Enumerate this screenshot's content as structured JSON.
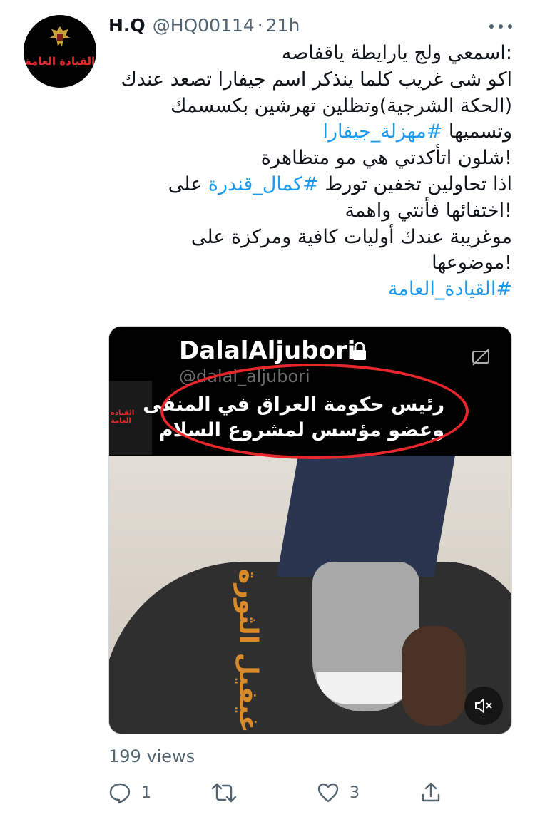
{
  "tweet": {
    "author": {
      "name": "H.Q",
      "handle": "@HQ00114",
      "separator": "·",
      "time": "21h",
      "avatar_text": "القيادة العامة"
    },
    "lines": [
      [
        {
          "text": ":اسمعي ولج يارايطة ياقفاصه",
          "tag": false
        }
      ],
      [
        {
          "text": "اكو شى غريب كلما ينذكر اسم جيفارا تصعد عندك",
          "tag": false
        }
      ],
      [
        {
          "text": "(الحكة الشرجية)وتظلين تهرشين بكسسمك",
          "tag": false
        }
      ],
      [
        {
          "text": "وتسميها ",
          "tag": false
        },
        {
          "text": "#مهزلة_جيفارا",
          "tag": true
        }
      ],
      [
        {
          "text": "!شلون اتأكدتي هي مو متظاهرة",
          "tag": false
        }
      ],
      [
        {
          "text": "اذا تحاولين تخفين تورط ",
          "tag": false
        },
        {
          "text": "#كمال_قندرة",
          "tag": true
        },
        {
          "text": " على",
          "tag": false
        }
      ],
      [
        {
          "text": "!اختفائها فأنتي واهمة",
          "tag": false
        }
      ],
      [
        {
          "text": "موغريبة عندك أوليات كافية ومركزة على",
          "tag": false
        }
      ],
      [
        {
          "text": "!موضوعها",
          "tag": false
        }
      ],
      [
        {
          "text": "#القيادة_العامة",
          "tag": true
        }
      ]
    ],
    "media": {
      "overlay_name": "DalalAljubori",
      "overlay_handle": "@dalal_aljubori",
      "caption_lines": [
        "رئيس حكومة العراق في المنفى",
        "وعضو مؤسس لمشروع السلام"
      ],
      "logo_text": "القيادة العامة",
      "jacket_text": "غيفيل الثورة"
    },
    "views": "199 views",
    "actions": {
      "reply_count": "1",
      "retweet_count": "",
      "like_count": "3"
    }
  },
  "colors": {
    "link": "#1d9bf0",
    "muted": "#536471",
    "text": "#0f1419",
    "ring": "#e8262b"
  },
  "icons": [
    "more-icon",
    "lock-icon",
    "captions-icon",
    "mute-icon",
    "reply-icon",
    "retweet-icon",
    "like-icon",
    "share-icon"
  ]
}
